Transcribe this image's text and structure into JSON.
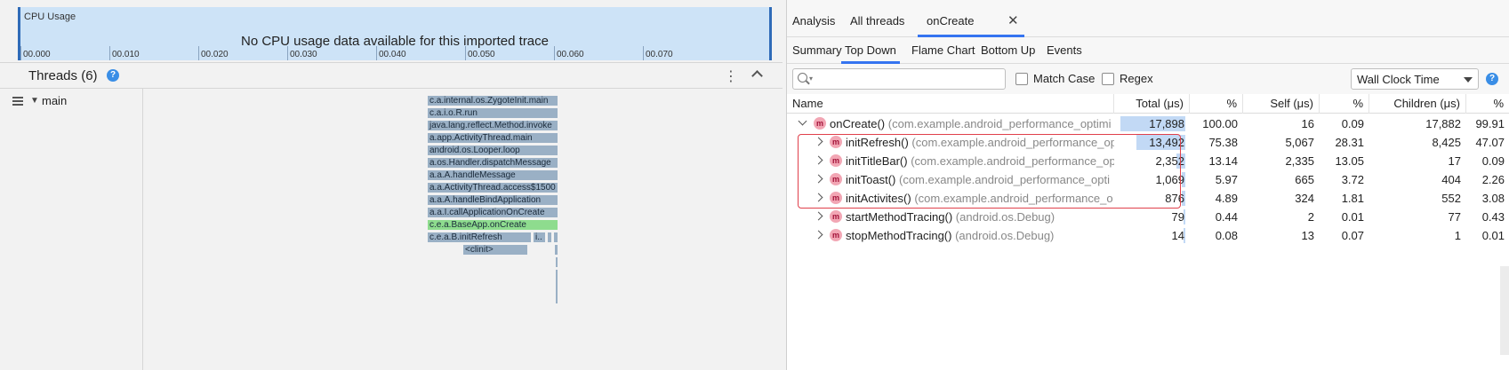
{
  "cpu": {
    "title": "CPU Usage",
    "message": "No CPU usage data available for this imported trace",
    "ticks": [
      "00.000",
      "00.010",
      "00.020",
      "00.030",
      "00.040",
      "00.050",
      "00.060",
      "00.070"
    ]
  },
  "threads": {
    "title": "Threads (6)",
    "help": "?",
    "menu": "⋮",
    "items": [
      {
        "name": "main"
      }
    ]
  },
  "flame_chart": [
    "c.a.internal.os.ZygoteInit.main",
    "c.a.i.o.R.run",
    "java.lang.reflect.Method.invoke",
    "a.app.ActivityThread.main",
    "android.os.Looper.loop",
    "a.os.Handler.dispatchMessage",
    "a.a.A.handleMessage",
    "a.a.ActivityThread.access$1500",
    "a.a.A.handleBindApplication",
    "a.a.I.callApplicationOnCreate",
    "c.e.a.BaseApp.onCreate",
    "c.e.a.B.initRefresh",
    "i..",
    "<clinit>"
  ],
  "tabs": {
    "analysis": "Analysis",
    "all_threads": "All threads",
    "oncreate": "onCreate",
    "close": "✕"
  },
  "subtabs": {
    "summary": "Summary",
    "top_down": "Top Down",
    "flame_chart": "Flame Chart",
    "bottom_up": "Bottom Up",
    "events": "Events"
  },
  "filter": {
    "search_placeholder": "",
    "match_case": "Match Case",
    "regex": "Regex",
    "clock": "Wall Clock Time",
    "help": "?"
  },
  "table": {
    "columns": [
      "Name",
      "Total (μs)",
      "%",
      "Self (μs)",
      "%",
      "Children (μs)",
      "%"
    ],
    "method_icon": "m",
    "rows": [
      {
        "name": "onCreate()",
        "pkg": "(com.example.android_performance_optimi",
        "total": "17,898",
        "total_pct": "100.00",
        "self": "16",
        "self_pct": "0.09",
        "children": "17,882",
        "children_pct": "99.91",
        "bar": 1.0
      },
      {
        "name": "initRefresh()",
        "pkg": "(com.example.android_performance_op",
        "total": "13,492",
        "total_pct": "75.38",
        "self": "5,067",
        "self_pct": "28.31",
        "children": "8,425",
        "children_pct": "47.07",
        "bar": 0.7538
      },
      {
        "name": "initTitleBar()",
        "pkg": "(com.example.android_performance_op",
        "total": "2,352",
        "total_pct": "13.14",
        "self": "2,335",
        "self_pct": "13.05",
        "children": "17",
        "children_pct": "0.09",
        "bar": 0.1314
      },
      {
        "name": "initToast()",
        "pkg": "(com.example.android_performance_opti",
        "total": "1,069",
        "total_pct": "5.97",
        "self": "665",
        "self_pct": "3.72",
        "children": "404",
        "children_pct": "2.26",
        "bar": 0.0597
      },
      {
        "name": "initActivites()",
        "pkg": "(com.example.android_performance_o",
        "total": "876",
        "total_pct": "4.89",
        "self": "324",
        "self_pct": "1.81",
        "children": "552",
        "children_pct": "3.08",
        "bar": 0.0489
      },
      {
        "name": "startMethodTracing()",
        "pkg": "(android.os.Debug)",
        "total": "79",
        "total_pct": "0.44",
        "self": "2",
        "self_pct": "0.01",
        "children": "77",
        "children_pct": "0.43",
        "bar": 0.0044
      },
      {
        "name": "stopMethodTracing()",
        "pkg": "(android.os.Debug)",
        "total": "14",
        "total_pct": "0.08",
        "self": "13",
        "self_pct": "0.07",
        "children": "1",
        "children_pct": "0.01",
        "bar": 0.0008
      }
    ]
  }
}
